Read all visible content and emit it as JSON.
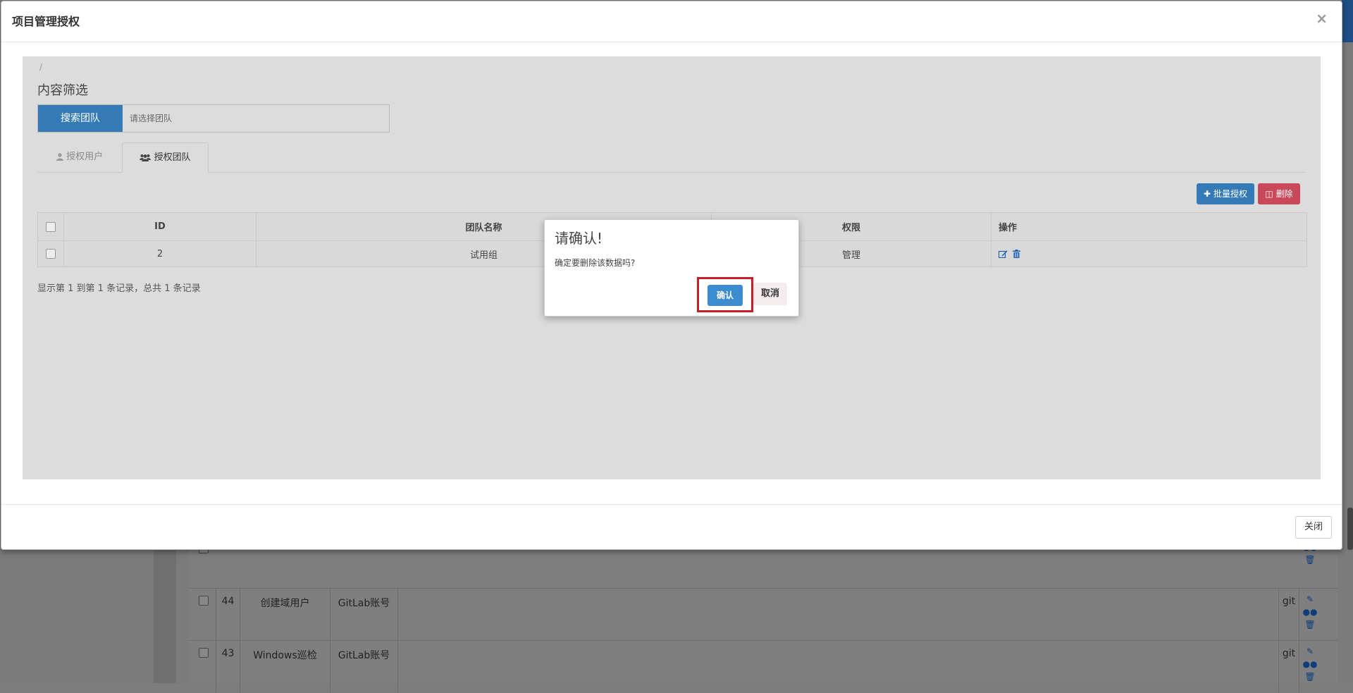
{
  "modal": {
    "title": "项目管理授权",
    "close_symbol": "×",
    "footer_close_label": "关闭"
  },
  "panel": {
    "breadcrumb": "/",
    "filter_title": "内容筛选",
    "search_button": "搜索团队",
    "search_placeholder": "请选择团队",
    "tabs": [
      {
        "label": "授权用户",
        "icon": "user-icon",
        "active": false
      },
      {
        "label": "授权团队",
        "icon": "users-icon",
        "active": true
      }
    ],
    "batch_auth_label": "批量授权",
    "delete_label": "删除",
    "table": {
      "headers": [
        "ID",
        "团队名称",
        "权限",
        "操作"
      ],
      "rows": [
        {
          "id": "2",
          "name": "试用组",
          "permission": "管理"
        }
      ]
    },
    "summary": "显示第 1 到第 1 条记录，总共 1 条记录"
  },
  "confirm": {
    "title": "请确认!",
    "message": "确定要删除该数据吗?",
    "ok_label": "确认",
    "cancel_label": "取消",
    "highlight_color": "#c81e2a"
  },
  "background_table": {
    "rows": [
      {
        "id": "44",
        "name": "创建域用户",
        "type": "GitLab账号",
        "repo": "git"
      },
      {
        "id": "43",
        "name": "Windows巡检",
        "type": "GitLab账号",
        "repo": "git"
      }
    ]
  },
  "colors": {
    "primary": "#337ab7",
    "danger": "#c9495a",
    "panel_gray": "#dcdcdc"
  }
}
